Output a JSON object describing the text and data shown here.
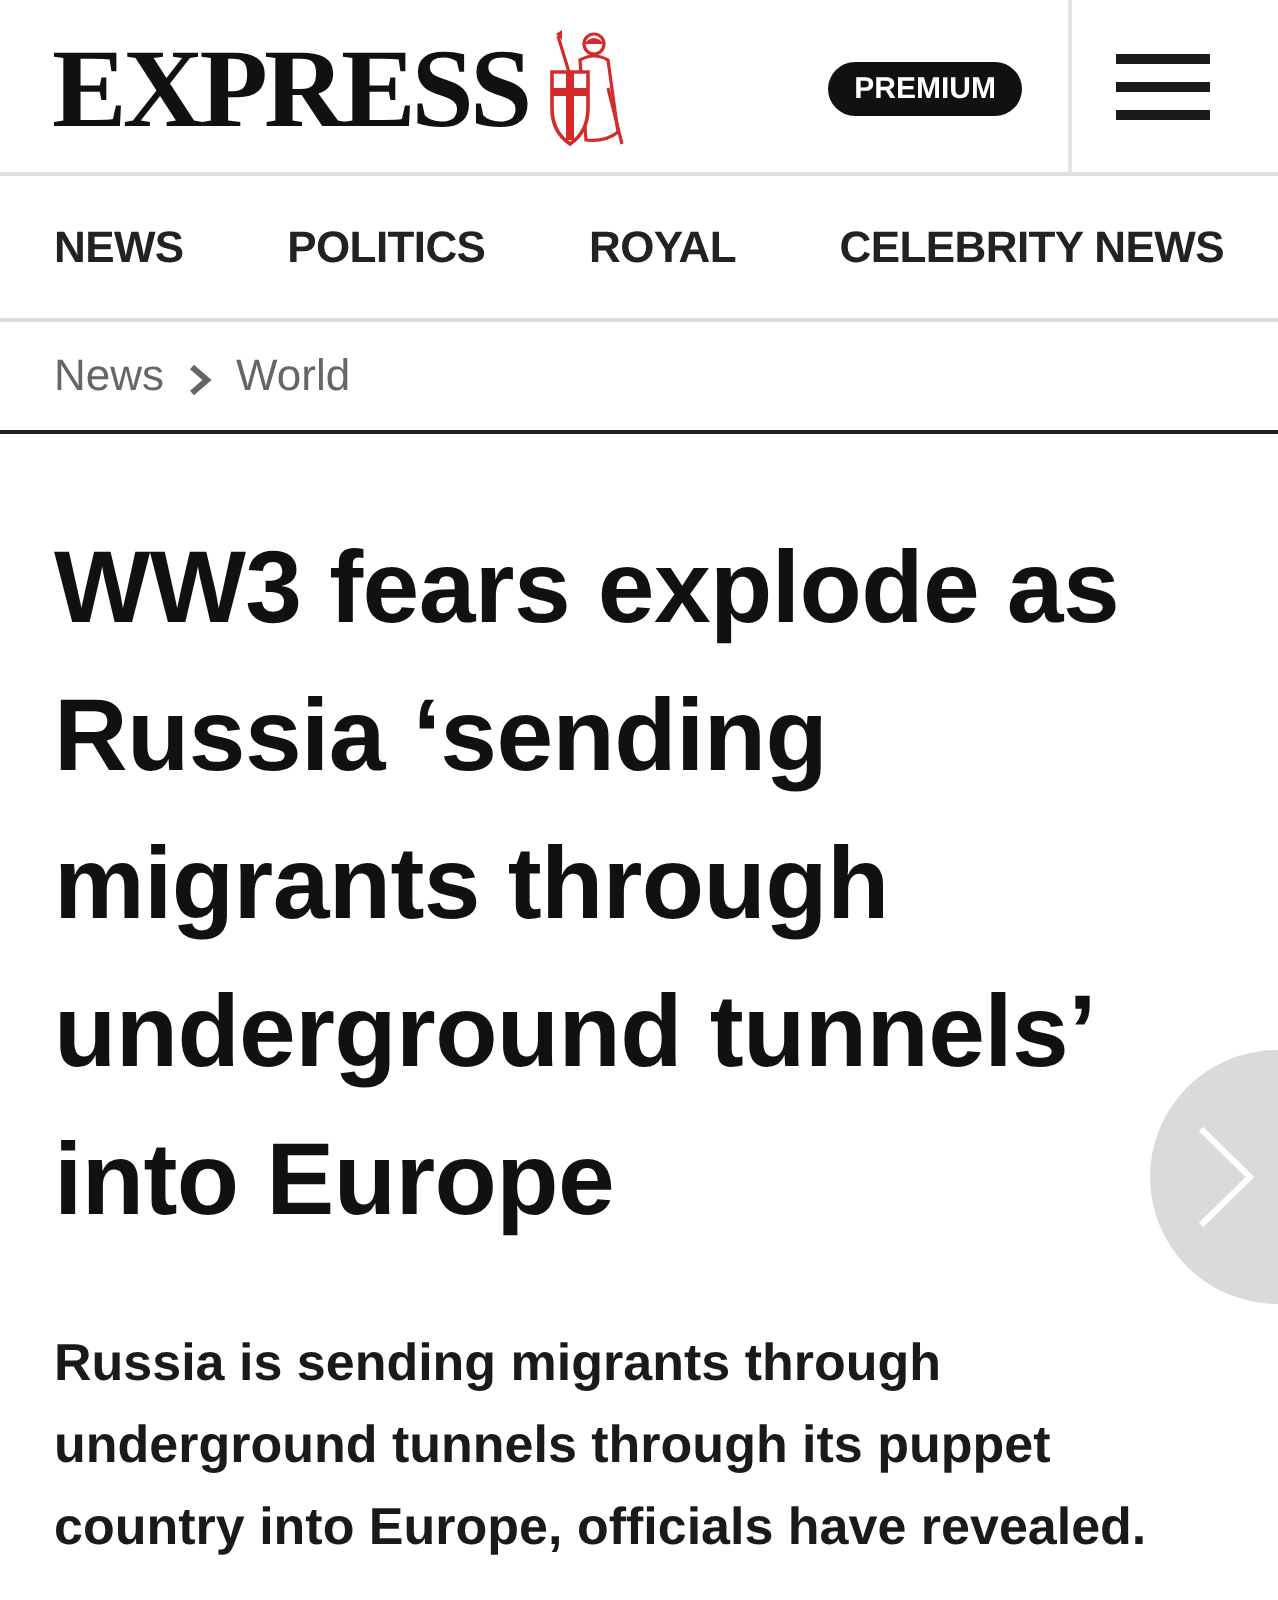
{
  "header": {
    "logo": "EXPRESS",
    "premium_badge": "PREMIUM"
  },
  "nav": {
    "items": [
      {
        "label": "NEWS"
      },
      {
        "label": "POLITICS"
      },
      {
        "label": "ROYAL"
      },
      {
        "label": "CELEBRITY NEWS"
      }
    ]
  },
  "breadcrumb": {
    "items": [
      "News",
      "World"
    ]
  },
  "article": {
    "headline": "WW3 fears explode as Russia ‘sending migrants through underground tunnels’ into Europe",
    "standfirst": "Russia is sending migrants through underground tunnels through its puppet country into Europe, officials have revealed."
  }
}
